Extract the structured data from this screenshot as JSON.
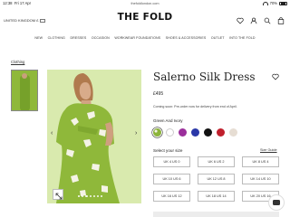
{
  "status_bar": {
    "time": "12:38",
    "date": "Fri 17 Apr",
    "url": "thefoldlondon.com",
    "battery": "70%"
  },
  "header": {
    "region_label": "UNITED KINGDOM £",
    "logo": "THE FOLD"
  },
  "nav": {
    "items": [
      "NEW",
      "CLOTHING",
      "DRESSES",
      "OCCASION",
      "WORKWEAR FOUNDATIONS",
      "SHOES & ACCESSORIES",
      "OUTLET",
      "INTO THE FOLD"
    ]
  },
  "breadcrumb": {
    "label": "Clothing"
  },
  "product": {
    "title": "Salerno Silk Dress",
    "price": "£495",
    "note": "Coming soon: Pre-order now for delivery from end of April.",
    "colour_name": "Green And Ivory",
    "swatch_colors": [
      "#8cb43a",
      "#ffffff",
      "#9b2f9b",
      "#2a38a8",
      "#111111",
      "#c01f2c",
      "#e6ddd3"
    ],
    "size_label": "Select your size",
    "size_guide": "Size Guide",
    "sizes": [
      "UK 4 US 0",
      "UK 6 US 2",
      "UK 8 US 4",
      "UK 10 US 6",
      "UK 12 US 8",
      "UK 14 US 10",
      "UK 16 US 12",
      "UK 18 US 14",
      "UK 20 US 16"
    ]
  },
  "colors": {
    "dress_green": "#8fb83a",
    "background_green": "#d6e8a7",
    "skin": "#d8ab8a"
  }
}
